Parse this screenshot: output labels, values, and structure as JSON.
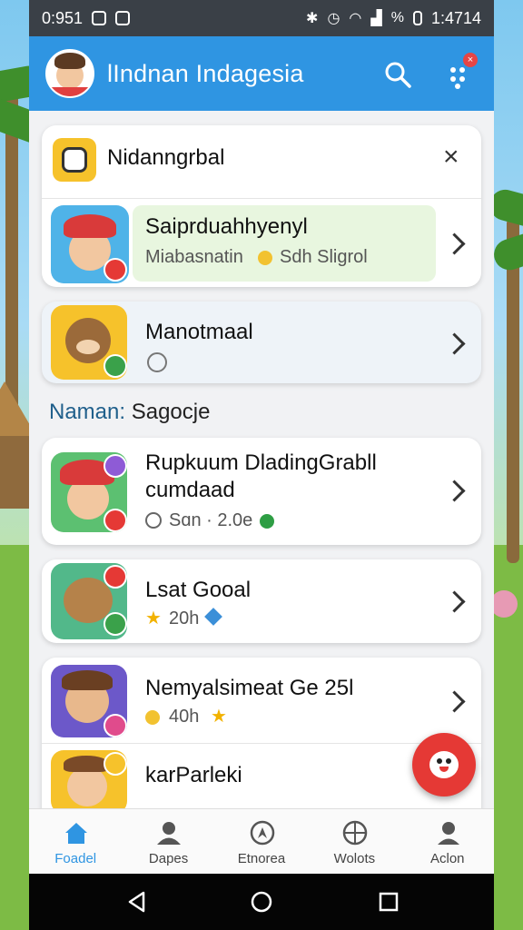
{
  "status": {
    "time": "0:951",
    "right_text": "1:4714"
  },
  "header": {
    "title": "lIndnan Indagesia",
    "notification_badge": "×",
    "search_icon": "search-icon",
    "apps_icon": "apps-grid-icon"
  },
  "cards": [
    {
      "title": "Nidanngrbal",
      "icon": "app-logo-icon",
      "close_label": "×",
      "item": {
        "title": "Saiprduahhyenyl",
        "subtitle_left": "Miabasnatin",
        "subtitle_right": "Sdh Sligrol",
        "highlight_color": "#e8f6df"
      }
    },
    {
      "title": "Manotmaal",
      "subtitle_icon": "clock-icon"
    }
  ],
  "section_header": {
    "label": "Naman:",
    "value": "Sagocje"
  },
  "items": [
    {
      "title": "Rupkuum DladingGrabll",
      "title2": "cumdaad",
      "meta_left": "Sɑn · 2.0e",
      "meta_icon": "timer-icon"
    },
    {
      "title": "Lsat Gooal",
      "meta_left": "20h",
      "meta_icon": "star-icon"
    },
    {
      "title": "Nemyalsimeat Ge 25l",
      "meta_left": "40h",
      "meta_icon": "coin-icon"
    },
    {
      "title": "karParleki"
    }
  ],
  "fab": {
    "icon": "mascot-icon"
  },
  "bottom_nav": [
    {
      "label": "Foadel",
      "icon": "home-icon",
      "active": true
    },
    {
      "label": "Dapes",
      "icon": "person-icon",
      "active": false
    },
    {
      "label": "Etnorea",
      "icon": "compass-icon",
      "active": false
    },
    {
      "label": "Wolots",
      "icon": "target-icon",
      "active": false
    },
    {
      "label": "Aclon",
      "icon": "profile-icon",
      "active": false
    }
  ],
  "colors": {
    "header": "#2f95e2",
    "accent": "#2f95e2",
    "fab": "#e53935"
  }
}
